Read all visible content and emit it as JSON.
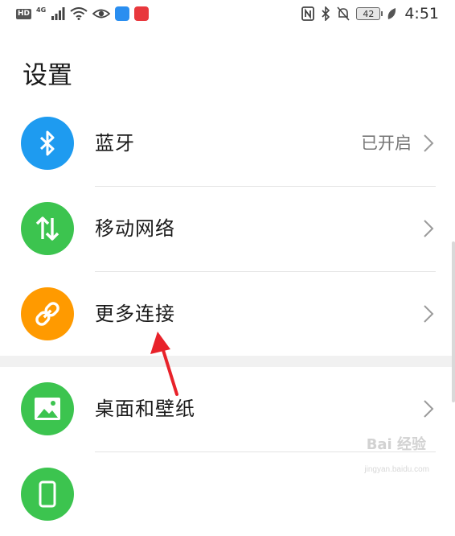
{
  "status_bar": {
    "hd": "HD",
    "network": "4G",
    "battery": "42",
    "time": "4:51"
  },
  "page": {
    "title": "设置"
  },
  "settings": {
    "bluetooth": {
      "label": "蓝牙",
      "status": "已开启",
      "icon": "bluetooth-icon",
      "color": "#1e9bf0"
    },
    "mobile_network": {
      "label": "移动网络",
      "icon": "mobile-data-icon",
      "color": "#3cc44f"
    },
    "more_connections": {
      "label": "更多连接",
      "icon": "link-icon",
      "color": "#ff9a00"
    },
    "wallpaper": {
      "label": "桌面和壁纸",
      "icon": "image-icon",
      "color": "#3cc44f"
    },
    "display": {
      "icon": "phone-icon",
      "color": "#3cc44f"
    }
  },
  "watermark": {
    "main": "Bai 经验",
    "sub": "jingyan.baidu.com"
  }
}
